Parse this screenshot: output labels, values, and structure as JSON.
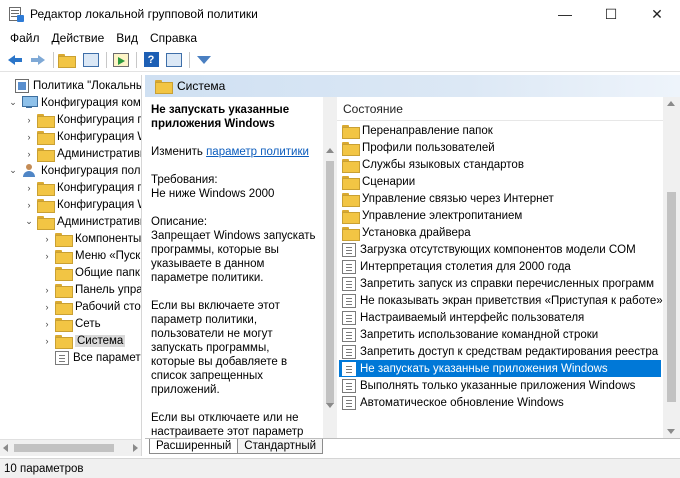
{
  "window": {
    "title": "Редактор локальной групповой политики",
    "controls": {
      "minimize": "—",
      "maximize": "☐",
      "close": "✕"
    }
  },
  "menu": [
    "Файл",
    "Действие",
    "Вид",
    "Справка"
  ],
  "toolbar": {
    "icons": [
      "back-icon",
      "forward-icon",
      "up-folder-icon",
      "show-hide-tree-icon",
      "export-list-icon",
      "help-icon",
      "properties-icon",
      "filter-icon"
    ],
    "help_glyph": "?"
  },
  "tree": {
    "items": [
      {
        "label": "Политика \"Локальный",
        "expander": "",
        "icon": "book"
      },
      {
        "label": "Конфигурация комп",
        "expander": "⌄",
        "icon": "computer"
      },
      {
        "label": "Конфигурация п",
        "expander": "›",
        "icon": "folder"
      },
      {
        "label": "Конфигурация W",
        "expander": "›",
        "icon": "folder"
      },
      {
        "label": "Административн",
        "expander": "›",
        "icon": "folder"
      },
      {
        "label": "Конфигурация поль",
        "expander": "⌄",
        "icon": "user"
      },
      {
        "label": "Конфигурация п",
        "expander": "›",
        "icon": "folder"
      },
      {
        "label": "Конфигурация W",
        "expander": "›",
        "icon": "folder"
      },
      {
        "label": "Административн",
        "expander": "⌄",
        "icon": "folder"
      },
      {
        "label": "Компоненты",
        "expander": "›",
        "icon": "folder"
      },
      {
        "label": "Меню «Пуск",
        "expander": "›",
        "icon": "folder"
      },
      {
        "label": "Общие папк",
        "expander": "",
        "icon": "folder"
      },
      {
        "label": "Панель упра",
        "expander": "›",
        "icon": "folder"
      },
      {
        "label": "Рабочий сто.",
        "expander": "›",
        "icon": "folder"
      },
      {
        "label": "Сеть",
        "expander": "›",
        "icon": "folder"
      },
      {
        "label": "Система",
        "expander": "›",
        "icon": "folder",
        "selected": true
      },
      {
        "label": "Все параметр",
        "expander": "",
        "icon": "policy"
      }
    ]
  },
  "header": {
    "title": "Система"
  },
  "description": {
    "title": "Не запускать указанные приложения Windows",
    "edit_prefix": "Изменить",
    "edit_link": "параметр политики",
    "req_label": "Требования:",
    "req_value": "Не ниже Windows 2000",
    "desc_label": "Описание:",
    "desc_text": "Запрещает Windows запускать программы, которые вы указываете в данном параметре политики.",
    "para2": "Если вы включаете этот параметр политики, пользователи не могут запускать программы, которые вы добавляете в список запрещенных приложений.",
    "para3": "Если вы отключаете или не настраиваете этот параметр политики, пользователи могут запускать любые программы."
  },
  "list": {
    "column_header": "Состояние",
    "items": [
      {
        "label": "Перенаправление папок",
        "type": "folder"
      },
      {
        "label": "Профили пользователей",
        "type": "folder"
      },
      {
        "label": "Службы языковых стандартов",
        "type": "folder"
      },
      {
        "label": "Сценарии",
        "type": "folder"
      },
      {
        "label": "Управление связью через Интернет",
        "type": "folder"
      },
      {
        "label": "Управление электропитанием",
        "type": "folder"
      },
      {
        "label": "Установка драйвера",
        "type": "folder"
      },
      {
        "label": "Загрузка отсутствующих компонентов модели COM",
        "type": "policy"
      },
      {
        "label": "Интерпретация столетия для 2000 года",
        "type": "policy"
      },
      {
        "label": "Запретить запуск из справки перечисленных программ",
        "type": "policy"
      },
      {
        "label": "Не показывать экран приветствия «Приступая к работе» п",
        "type": "policy"
      },
      {
        "label": "Настраиваемый интерфейс пользователя",
        "type": "policy"
      },
      {
        "label": "Запретить использование командной строки",
        "type": "policy"
      },
      {
        "label": "Запретить доступ к средствам редактирования реестра",
        "type": "policy"
      },
      {
        "label": "Не запускать указанные приложения Windows",
        "type": "policy",
        "selected": true
      },
      {
        "label": "Выполнять только указанные приложения Windows",
        "type": "policy"
      },
      {
        "label": "Автоматическое обновление Windows",
        "type": "policy"
      }
    ]
  },
  "tabs": [
    "Расширенный",
    "Стандартный"
  ],
  "status": {
    "text": "10 параметров"
  }
}
